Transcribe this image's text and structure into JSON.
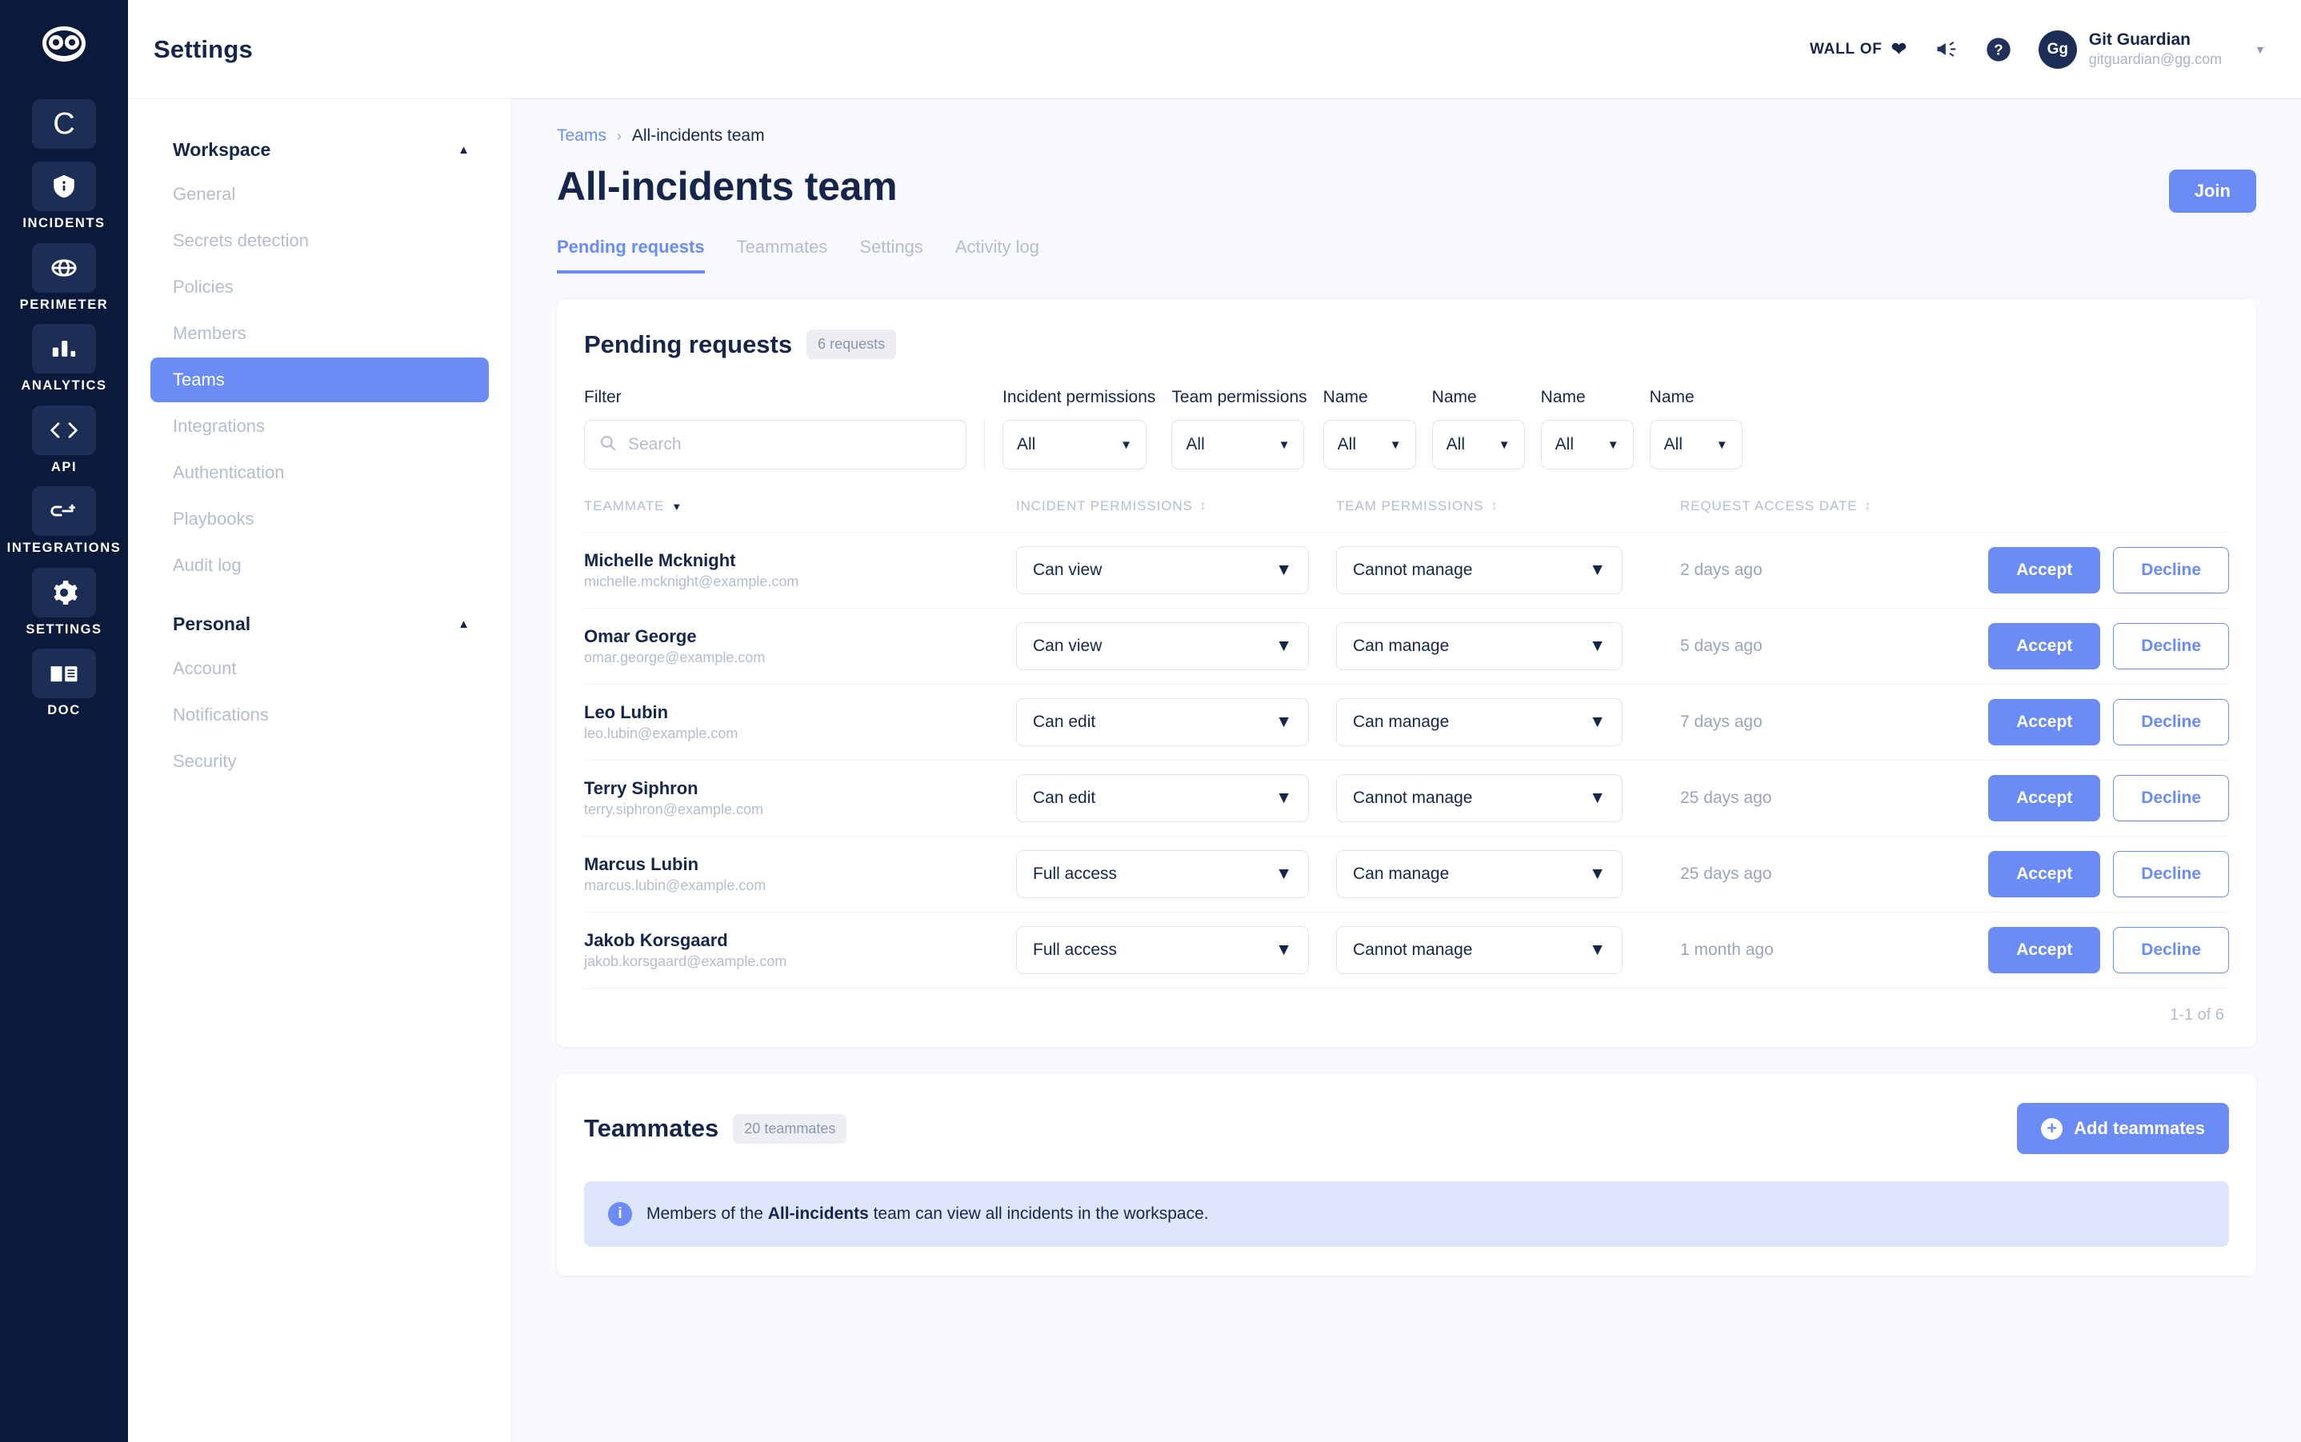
{
  "rail": {
    "logo_icon": "owl-logo-icon",
    "items": [
      {
        "label": "",
        "icon": "letter-c-icon",
        "name": "workspace-switcher"
      },
      {
        "label": "INCIDENTS",
        "icon": "shield-info-icon",
        "name": "incidents"
      },
      {
        "label": "PERIMETER",
        "icon": "globe-icon",
        "name": "perimeter"
      },
      {
        "label": "ANALYTICS",
        "icon": "bar-chart-icon",
        "name": "analytics"
      },
      {
        "label": "API",
        "icon": "code-brackets-icon",
        "name": "api"
      },
      {
        "label": "INTEGRATIONS",
        "icon": "plug-link-icon",
        "name": "integrations"
      },
      {
        "label": "SETTINGS",
        "icon": "gear-icon",
        "name": "settings"
      },
      {
        "label": "DOC",
        "icon": "book-icon",
        "name": "doc"
      }
    ]
  },
  "topbar": {
    "title": "Settings",
    "wall_of_label": "WALL OF",
    "heart_icon": "heart-icon",
    "megaphone_icon": "megaphone-icon",
    "help_icon": "question-circle-icon",
    "avatar_initials": "Gg",
    "user_name": "Git Guardian",
    "user_email": "gitguardian@gg.com",
    "caret_icon": "chevron-down-icon"
  },
  "settings_nav": {
    "groups": [
      {
        "title": "Workspace",
        "collapse_icon": "chevron-up-icon",
        "items": [
          {
            "label": "General",
            "active": false
          },
          {
            "label": "Secrets detection",
            "active": false
          },
          {
            "label": "Policies",
            "active": false
          },
          {
            "label": "Members",
            "active": false
          },
          {
            "label": "Teams",
            "active": true
          },
          {
            "label": "Integrations",
            "active": false
          },
          {
            "label": "Authentication",
            "active": false
          },
          {
            "label": "Playbooks",
            "active": false
          },
          {
            "label": "Audit log",
            "active": false
          }
        ]
      },
      {
        "title": "Personal",
        "collapse_icon": "chevron-up-icon",
        "items": [
          {
            "label": "Account",
            "active": false
          },
          {
            "label": "Notifications",
            "active": false
          },
          {
            "label": "Security",
            "active": false
          }
        ]
      }
    ]
  },
  "breadcrumb": {
    "root": "Teams",
    "separator": "›",
    "current": "All-incidents team"
  },
  "page": {
    "title": "All-incidents team",
    "join_label": "Join",
    "tabs": [
      {
        "label": "Pending requests",
        "active": true
      },
      {
        "label": "Teammates",
        "active": false
      },
      {
        "label": "Settings",
        "active": false
      },
      {
        "label": "Activity log",
        "active": false
      }
    ]
  },
  "pending": {
    "title": "Pending requests",
    "count_badge": "6 requests",
    "filters": {
      "filter_label": "Filter",
      "search_placeholder": "Search",
      "search_value": "",
      "search_icon": "search-icon",
      "dropdowns": [
        {
          "label": "Incident permissions",
          "value": "All",
          "width": 180
        },
        {
          "label": "Team permissions",
          "value": "All",
          "width": 166
        },
        {
          "label": "Name",
          "value": "All",
          "width": 116
        },
        {
          "label": "Name",
          "value": "All",
          "width": 116
        },
        {
          "label": "Name",
          "value": "All",
          "width": 116
        },
        {
          "label": "Name",
          "value": "All",
          "width": 116
        }
      ]
    },
    "columns": [
      {
        "label": "TEAMMATE",
        "sort_icon": "caret-down-icon"
      },
      {
        "label": "INCIDENT PERMISSIONS",
        "sort_icon": "sort-updown-icon"
      },
      {
        "label": "TEAM PERMISSIONS",
        "sort_icon": "sort-updown-icon"
      },
      {
        "label": "REQUEST ACCESS DATE",
        "sort_icon": "sort-updown-icon"
      },
      {
        "label": "",
        "sort_icon": ""
      }
    ],
    "rows": [
      {
        "name": "Michelle Mcknight",
        "email": "michelle.mcknight@example.com",
        "incident_permission": "Can view",
        "team_permission": "Cannot manage",
        "date": "2 days ago",
        "accept": "Accept",
        "decline": "Decline"
      },
      {
        "name": "Omar George",
        "email": "omar.george@example.com",
        "incident_permission": "Can view",
        "team_permission": "Can manage",
        "date": "5 days ago",
        "accept": "Accept",
        "decline": "Decline"
      },
      {
        "name": "Leo Lubin",
        "email": "leo.lubin@example.com",
        "incident_permission": "Can edit",
        "team_permission": "Can manage",
        "date": "7 days ago",
        "accept": "Accept",
        "decline": "Decline"
      },
      {
        "name": "Terry Siphron",
        "email": "terry.siphron@example.com",
        "incident_permission": "Can edit",
        "team_permission": "Cannot manage",
        "date": "25 days ago",
        "accept": "Accept",
        "decline": "Decline"
      },
      {
        "name": "Marcus Lubin",
        "email": "marcus.lubin@example.com",
        "incident_permission": "Full access",
        "team_permission": "Can manage",
        "date": "25 days ago",
        "accept": "Accept",
        "decline": "Decline"
      },
      {
        "name": "Jakob Korsgaard",
        "email": "jakob.korsgaard@example.com",
        "incident_permission": "Full access",
        "team_permission": "Cannot manage",
        "date": "1 month ago",
        "accept": "Accept",
        "decline": "Decline"
      }
    ],
    "pagination": "1-1 of 6"
  },
  "teammates": {
    "title": "Teammates",
    "count_badge": "20 teammates",
    "add_label": "Add teammates",
    "add_icon": "plus-circle-icon",
    "banner_icon": "info-icon",
    "banner_prefix": "Members of the ",
    "banner_bold": "All-incidents",
    "banner_suffix": " team can view all incidents in the workspace."
  },
  "colors": {
    "accent": "#6c8cf5",
    "navy": "#0b1a3a",
    "text": "#16264b",
    "muted": "#b4bdcd",
    "page_bg": "#f7f9fd",
    "banner_bg": "#dde6fd"
  }
}
